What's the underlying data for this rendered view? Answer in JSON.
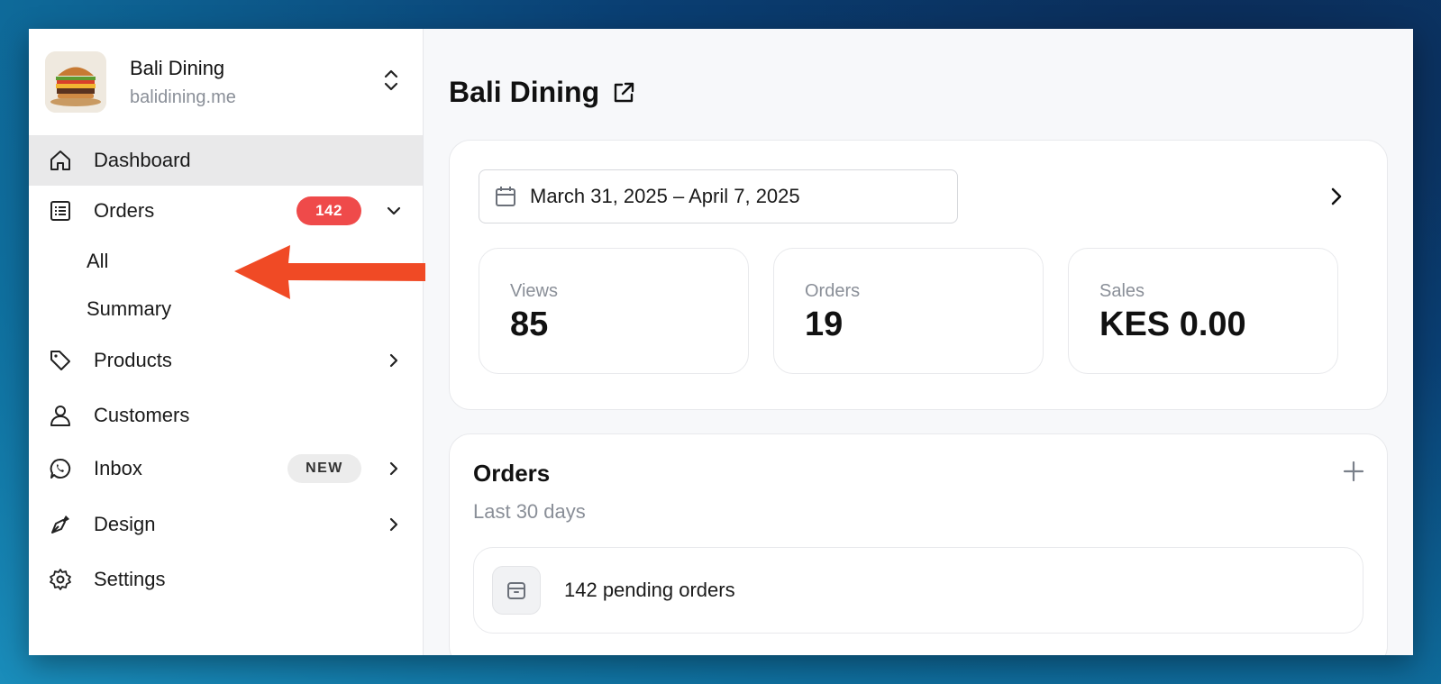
{
  "store": {
    "name": "Bali Dining",
    "domain": "balidining.me"
  },
  "sidebar": {
    "items": [
      {
        "label": "Dashboard",
        "icon": "home-icon"
      },
      {
        "label": "Orders",
        "icon": "orders-icon",
        "badge": "142"
      },
      {
        "label": "Products",
        "icon": "tag-icon"
      },
      {
        "label": "Customers",
        "icon": "user-icon"
      },
      {
        "label": "Inbox",
        "icon": "whatsapp-icon",
        "badge": "NEW"
      },
      {
        "label": "Design",
        "icon": "pen-icon"
      },
      {
        "label": "Settings",
        "icon": "gear-icon"
      }
    ],
    "orders_sub": [
      "All",
      "Summary"
    ]
  },
  "main": {
    "title": "Bali Dining",
    "date_range": "March 31, 2025 – April 7, 2025",
    "stats": [
      {
        "label": "Views",
        "value": "85"
      },
      {
        "label": "Orders",
        "value": "19"
      },
      {
        "label": "Sales",
        "value": "KES 0.00"
      }
    ],
    "orders_card": {
      "title": "Orders",
      "subtitle": "Last 30 days",
      "pending": "142 pending orders"
    }
  },
  "colors": {
    "accent_red": "#ef4a4a",
    "arrow": "#f04a25",
    "active_bg": "#e9e9ea"
  }
}
